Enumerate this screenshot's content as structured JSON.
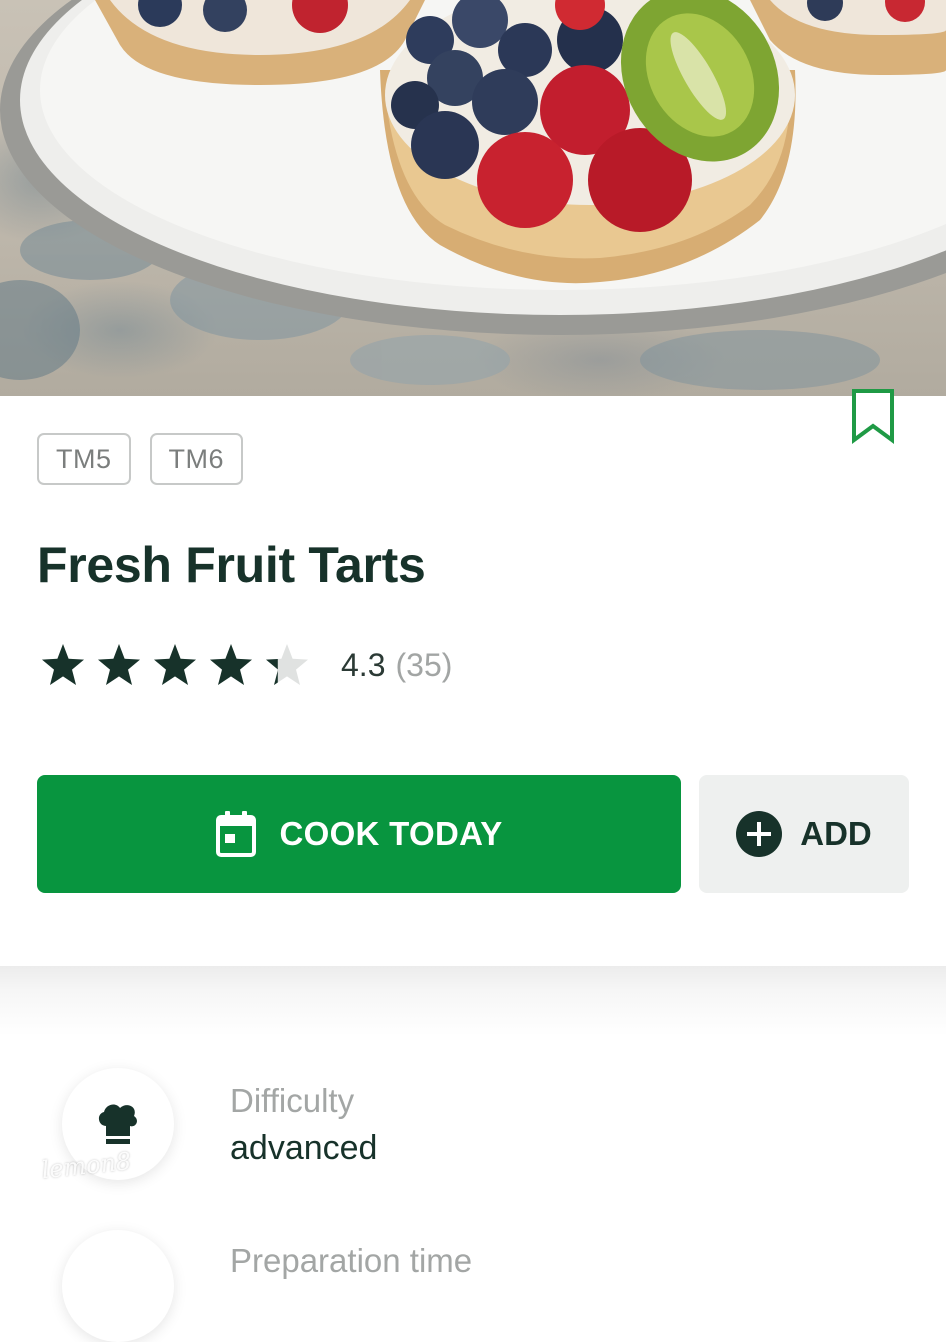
{
  "tags": [
    "TM5",
    "TM6"
  ],
  "recipe": {
    "title": "Fresh Fruit Tarts"
  },
  "rating": {
    "stars_filled": 4.3,
    "stars_max": 5,
    "value": "4.3",
    "count": "(35)"
  },
  "actions": {
    "cook_label": "COOK TODAY",
    "add_label": "ADD"
  },
  "details": {
    "difficulty_label": "Difficulty",
    "difficulty_value": "advanced",
    "prep_label": "Preparation time"
  },
  "icons": {
    "bookmark": "bookmark-outline-icon",
    "cook": "calendar-icon",
    "add": "plus-circle-icon",
    "difficulty": "chef-hat-icon"
  },
  "colors": {
    "primary_green": "#08953f",
    "title_dark_green": "#17322a",
    "bookmark_green": "#1f9a45",
    "star_dark": "#17322a",
    "star_empty": "#e0e2e1"
  },
  "watermark": "lemon8"
}
